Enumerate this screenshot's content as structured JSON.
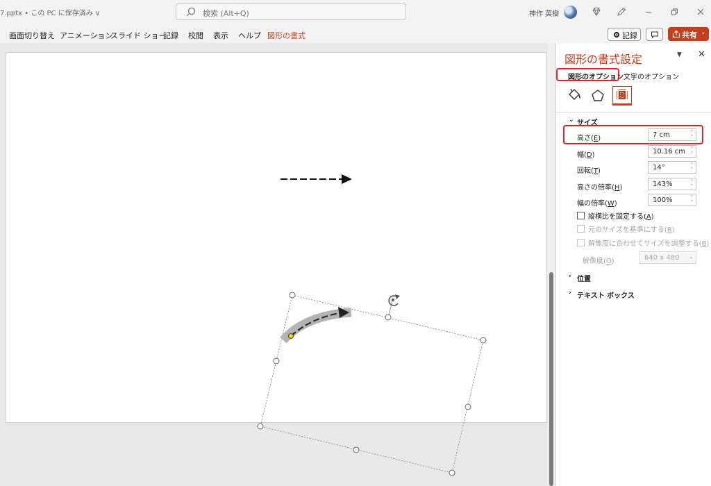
{
  "titlebar": {
    "document_title": "7.pptx • この PC に保存済み ∨",
    "search_placeholder": "検索 (Alt+Q)",
    "user_name": "神作 英樹"
  },
  "ribbon": {
    "tabs": [
      "画面切り替え",
      "アニメーション",
      "スライド ショー",
      "記録",
      "校閲",
      "表示",
      "ヘルプ",
      "図形の書式"
    ],
    "active_tab": "図形の書式",
    "record_label": "記録",
    "share_label": "共有"
  },
  "pane": {
    "title": "図形の書式設定",
    "tabs": {
      "shape_options": "図形のオプション",
      "text_options": "文字のオプション"
    },
    "icons": [
      "fill-line-icon",
      "effects-pentagon-icon",
      "size-properties-icon"
    ],
    "size_section": {
      "header": "サイズ",
      "height": {
        "label": "高さ(",
        "key": "E",
        "value": "7 cm"
      },
      "width": {
        "label": "幅(",
        "key": "D",
        "value": "10.16 cm"
      },
      "rotation": {
        "label": "回転(",
        "key": "T",
        "value": "14°"
      },
      "scale_height": {
        "label": "高さの倍率(",
        "key": "H",
        "value": "143%"
      },
      "scale_width": {
        "label": "幅の倍率(",
        "key": "W",
        "value": "100%"
      },
      "lock_aspect": {
        "label": "縦横比を固定する(",
        "key": "A",
        "checked": false
      },
      "relative_original": {
        "label": "元のサイズを基準にする(",
        "key": "R",
        "checked": false,
        "disabled": true
      },
      "best_scale": {
        "label": "解像度に合わせてサイズを調整する(",
        "key": "B",
        "checked": false,
        "disabled": true
      },
      "resolution": {
        "label": "解像度(",
        "key": "O",
        "value": "640 x 480",
        "disabled": true
      }
    },
    "position_section": {
      "header": "位置"
    },
    "textbox_section": {
      "header": "テキスト ボックス"
    }
  },
  "colors": {
    "accent": "#c43e1c",
    "highlight": "#e0202e",
    "handle_yellow": "#f3d400"
  }
}
